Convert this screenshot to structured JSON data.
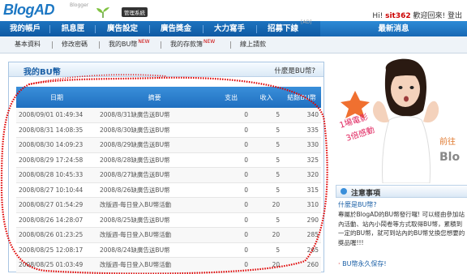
{
  "brand": {
    "logo": "BlogAD",
    "sub": "Blogger",
    "badge": "管理系統"
  },
  "user": {
    "greeting": "Hi!",
    "name": "sit362",
    "welcome": "歡迎回來!",
    "logout": "登出"
  },
  "nav": {
    "items": [
      "我的帳戶",
      "訊息匣",
      "廣告設定",
      "廣告獎金",
      "大力寫手",
      "招募下線"
    ],
    "ad_tag": "[AD]",
    "news": "最新消息"
  },
  "subnav": [
    {
      "label": "基本資料",
      "new": ""
    },
    {
      "label": "修改密碼",
      "new": ""
    },
    {
      "label": "我的BU幣",
      "new": "NEW"
    },
    {
      "label": "我的存款簿",
      "new": "NEW"
    },
    {
      "label": "線上請款",
      "new": ""
    }
  ],
  "panel": {
    "title": "我的BU幣",
    "link": "什麼是BU幣?",
    "headers": [
      "日期",
      "摘要",
      "支出",
      "收入",
      "結餘BU幣"
    ],
    "rows": [
      {
        "date": "2008/09/01 01:49:34",
        "desc": "2008/8/31缺廣告送BU幣",
        "out": "0",
        "in": "5",
        "bal": "340"
      },
      {
        "date": "2008/08/31 14:08:35",
        "desc": "2008/8/30缺廣告送BU幣",
        "out": "0",
        "in": "5",
        "bal": "335"
      },
      {
        "date": "2008/08/30 14:09:23",
        "desc": "2008/8/29缺廣告送BU幣",
        "out": "0",
        "in": "5",
        "bal": "330"
      },
      {
        "date": "2008/08/29 17:24:58",
        "desc": "2008/8/28缺廣告送BU幣",
        "out": "0",
        "in": "5",
        "bal": "325"
      },
      {
        "date": "2008/08/28 10:45:33",
        "desc": "2008/8/27缺廣告送BU幣",
        "out": "0",
        "in": "5",
        "bal": "320"
      },
      {
        "date": "2008/08/27 10:10:44",
        "desc": "2008/8/26缺廣告送BU幣",
        "out": "0",
        "in": "5",
        "bal": "315"
      },
      {
        "date": "2008/08/27 01:54:29",
        "desc": "改版週-每日登入BU幣活動",
        "out": "0",
        "in": "20",
        "bal": "310"
      },
      {
        "date": "2008/08/26 14:28:07",
        "desc": "2008/8/25缺廣告送BU幣",
        "out": "0",
        "in": "5",
        "bal": "290"
      },
      {
        "date": "2008/08/26 01:23:25",
        "desc": "改版週-每日登入BU幣活動",
        "out": "0",
        "in": "20",
        "bal": "285"
      },
      {
        "date": "2008/08/25 12:08:17",
        "desc": "2008/8/24缺廣告送BU幣",
        "out": "0",
        "in": "5",
        "bal": "265"
      },
      {
        "date": "2008/08/25 01:03:49",
        "desc": "改版週-每日登入BU幣活動",
        "out": "0",
        "in": "20",
        "bal": "260"
      }
    ]
  },
  "promo": {
    "line1": "1場電影",
    "line2": "3倍感動",
    "arrow": "前往",
    "brand": "Blo"
  },
  "notice": {
    "title": "注意事項",
    "question": "什麼是BU幣?",
    "body": "專屬於BlogAD的BU幣發行囉! 可以經由參加站內活動、站內小鬧卷等方式取得BU幣，累積到一定的BU幣，就可到站內的BU幣兌換您想要的獎品喔!!!",
    "footer": "BU幣永久保存!"
  },
  "colors": {
    "accent": "#1c77c3",
    "nav_bg": "#1565b3",
    "circle": "#e00000"
  }
}
